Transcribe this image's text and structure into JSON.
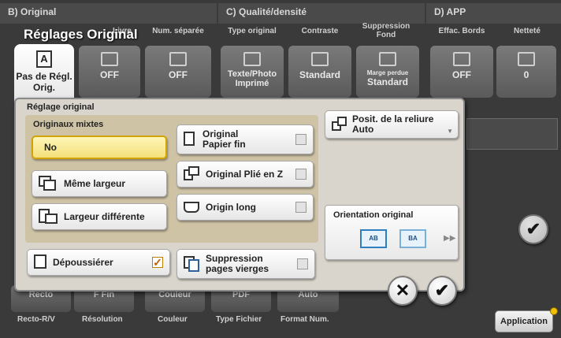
{
  "background": {
    "sections": [
      {
        "label": "B)  Original"
      },
      {
        "label": "C)  Qualité/densité"
      },
      {
        "label": "D)  APP"
      }
    ],
    "column_headers": [
      "Livre",
      "Num. séparée",
      "Type original",
      "Contraste",
      "Suppression Fond",
      "Effac. Bords",
      "Netteté"
    ],
    "buttons": [
      {
        "label": "OFF"
      },
      {
        "label": "OFF"
      },
      {
        "label": "Texte/Photo Imprimé"
      },
      {
        "label": "Standard"
      },
      {
        "label": "Standard",
        "sub": "Marge perdue"
      },
      {
        "label": "OFF"
      },
      {
        "label": "0"
      }
    ],
    "bottom_buttons": [
      "Recto",
      "F Fin",
      "Couleur",
      "PDF",
      "Auto"
    ],
    "bottom_labels": [
      "Recto-R/V",
      "Résolution",
      "Couleur",
      "Type Fichier",
      "Format Num."
    ],
    "application_label": "Application"
  },
  "active_tab": {
    "title": "Réglages Original",
    "button_label": "Pas de Régl. Orig.",
    "icon_glyph": "A"
  },
  "dialog": {
    "title": "Réglage original",
    "mixed_title": "Originaux mixtes",
    "mixed_options": [
      {
        "label": "No",
        "selected": true
      },
      {
        "label": "Même largeur",
        "selected": false
      },
      {
        "label": "Largeur différente",
        "selected": false
      }
    ],
    "checkbox_options": [
      {
        "label_line1": "Original",
        "label_line2": "Papier fin",
        "checked": false
      },
      {
        "label_line1": "Original Plié en Z",
        "label_line2": "",
        "checked": false
      },
      {
        "label_line1": "Origin long",
        "label_line2": "",
        "checked": false
      }
    ],
    "binding": {
      "label": "Posit. de la reliure",
      "value": "Auto"
    },
    "orientation": {
      "title": "Orientation original",
      "options": [
        "AB",
        "BA"
      ]
    },
    "depoussierer": {
      "label": "Dépoussiérer",
      "checked": true
    },
    "suppression": {
      "label_line1": "Suppression",
      "label_line2": "pages vierges",
      "checked": false
    }
  },
  "actions": {
    "cancel_glyph": "✕",
    "ok_glyph": "✔"
  }
}
